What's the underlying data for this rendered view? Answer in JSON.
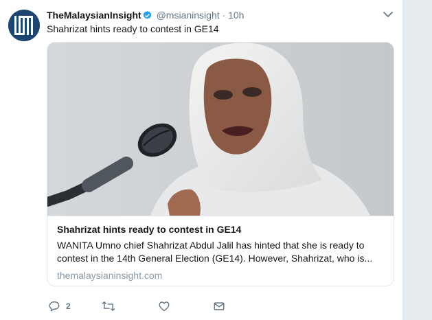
{
  "tweet": {
    "author_name": "TheMalaysianInsight",
    "handle": "@msianinsight",
    "separator": "·",
    "time": "10h",
    "text": "Shahrizat hints ready to contest in GE14",
    "verified_icon": "verified-badge-icon",
    "avatar_icon": "the-malaysian-insight-logo",
    "caret_icon": "chevron-down-icon"
  },
  "card": {
    "image_description_icon": "news-photo",
    "title": "Shahrizat hints ready to contest in GE14",
    "description_line1": "WANITA Umno chief Shahrizat Abdul Jalil has hinted that she is ready to",
    "description_line2": "contest in the 14th General Election (GE14). However, Shahrizat, who is...",
    "domain": "themalaysianinsight.com"
  },
  "actions": {
    "reply_icon": "reply-icon",
    "reply_count": "2",
    "retweet_icon": "retweet-icon",
    "like_icon": "heart-icon",
    "dm_icon": "envelope-icon"
  },
  "colors": {
    "accent": "#1da1f2",
    "secondary_text": "#657786",
    "background": "#e6ecf0"
  }
}
